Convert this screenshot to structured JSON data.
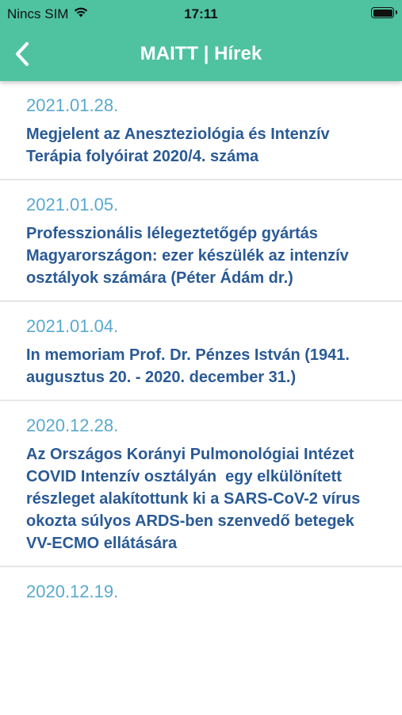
{
  "status_bar": {
    "carrier": "Nincs SIM",
    "time": "17:11"
  },
  "header": {
    "title": "MAITT | Hírek",
    "back_icon": "chevron-left-icon",
    "color": "#4fc2a0"
  },
  "news": [
    {
      "date": "2021.01.28.",
      "title": "Megjelent az Aneszteziológia és Intenzív Terápia folyóirat 2020/4. száma"
    },
    {
      "date": "2021.01.05.",
      "title": "Professzionális lélegeztetőgép gyártás Magyarországon: ezer készülék az intenzív osztályok számára (Péter Ádám dr.)"
    },
    {
      "date": "2021.01.04.",
      "title": "In memoriam Prof. Dr. Pénzes István (1941. augusztus 20. - 2020. december 31.)"
    },
    {
      "date": "2020.12.28.",
      "title": "Az Országos Korányi Pulmonológiai Intézet COVID Intenzív osztályán  egy elkülönített részleget alakítottunk ki a SARS-CoV-2 vírus okozta súlyos ARDS-ben szenvedő betegek VV-ECMO ellátására"
    },
    {
      "date": "2020.12.19.",
      "title": ""
    }
  ],
  "colors": {
    "date": "#5aa9cf",
    "title": "#2a5a95",
    "divider": "#e6e6e6"
  }
}
